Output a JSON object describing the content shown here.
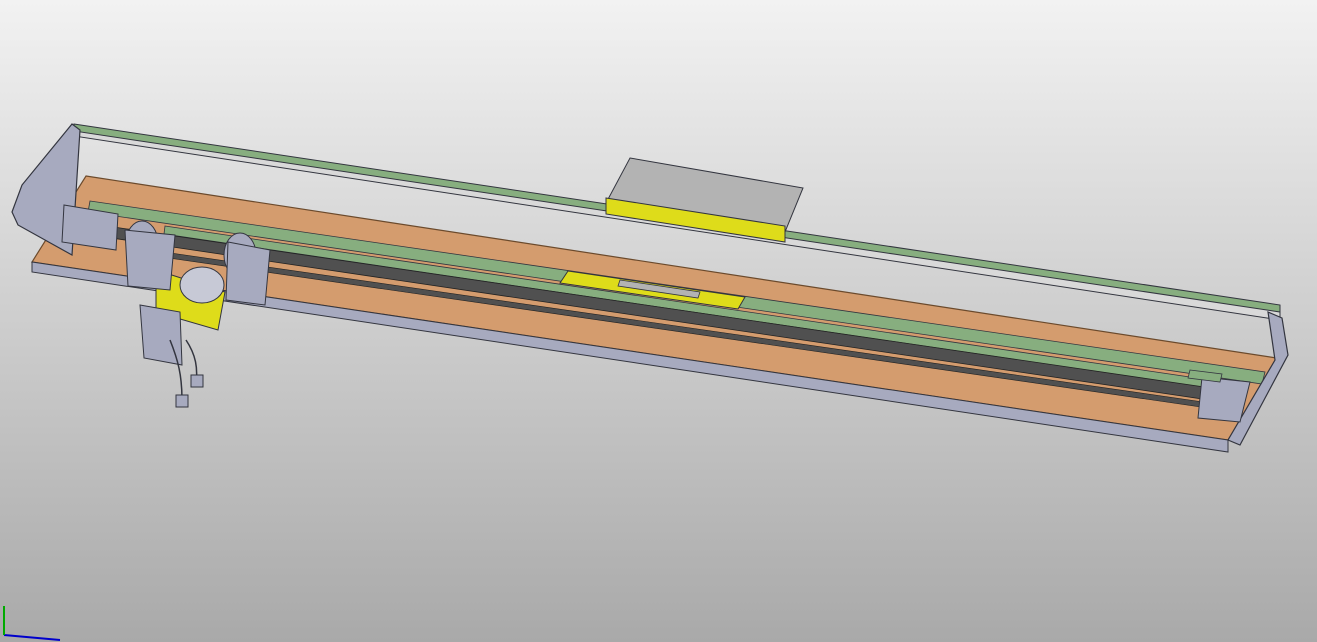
{
  "viewport": {
    "background_top": "#f2f2f2",
    "background_bottom": "#a9a9a9"
  },
  "colors": {
    "frame_steel": "#a7aabf",
    "frame_edge": "#33353f",
    "base_plate": "#d49c6e",
    "base_plate_edge": "#6b4a2c",
    "guide_strip": "#87ae7f",
    "belt": "#505050",
    "carriage": "#dedc1a",
    "cover_grey": "#b3b3b3",
    "triad_x": "#0000cc",
    "triad_y": "#00aa00"
  },
  "icons": {
    "assembly": "linear-actuator-assembly-icon",
    "motor": "stepper-motor-icon",
    "triad": "axis-triad-icon"
  }
}
